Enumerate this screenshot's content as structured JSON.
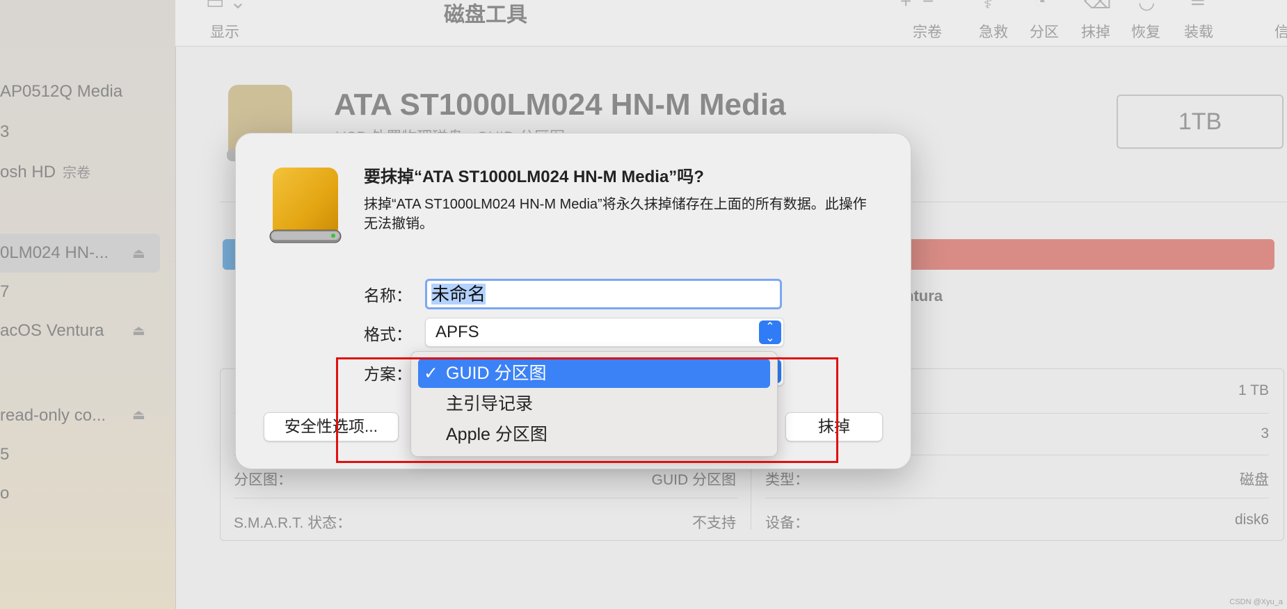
{
  "app": {
    "title": "磁盘工具",
    "view_label": "显示"
  },
  "toolbar": {
    "items": [
      {
        "label": "宗卷",
        "icon": "plus-minus-icon"
      },
      {
        "label": "急救",
        "icon": "stethoscope-icon"
      },
      {
        "label": "分区",
        "icon": "pie-icon"
      },
      {
        "label": "抹掉",
        "icon": "erase-icon"
      },
      {
        "label": "恢复",
        "icon": "restore-icon"
      },
      {
        "label": "装载",
        "icon": "mount-icon"
      },
      {
        "label": "信",
        "icon": "info-icon"
      }
    ]
  },
  "sidebar": {
    "items": [
      {
        "label": "AP0512Q Media",
        "tag": ""
      },
      {
        "label": "3",
        "tag": ""
      },
      {
        "label": "osh HD",
        "tag": "宗卷"
      },
      {
        "label": "0LM024 HN-...",
        "tag": ""
      },
      {
        "label": "7",
        "tag": ""
      },
      {
        "label": "acOS Ventura",
        "tag": ""
      },
      {
        "label": "read-only co...",
        "tag": ""
      },
      {
        "label": "5",
        "tag": ""
      },
      {
        "label": "o",
        "tag": ""
      }
    ]
  },
  "disk": {
    "title": "ATA ST1000LM024 HN-M Media",
    "subtitle": "USB 外置物理磁盘 · GUID 分区图",
    "size": "1TB",
    "usage_legend": "ntura"
  },
  "info": {
    "rows": [
      {
        "left_label": "",
        "left_value": "",
        "right_label": "",
        "right_value": "1 TB"
      },
      {
        "left_label": "",
        "left_value": "",
        "right_label": "",
        "right_value": "3"
      },
      {
        "left_label": "分区图：",
        "left_value": "GUID 分区图",
        "right_label": "类型：",
        "right_value": "磁盘"
      },
      {
        "left_label": "S.M.A.R.T. 状态：",
        "left_value": "不支持",
        "right_label": "设备：",
        "right_value": "disk6"
      }
    ]
  },
  "dialog": {
    "title": "要抹掉“ATA ST1000LM024 HN-M Media”吗?",
    "message": "抹掉“ATA ST1000LM024 HN-M Media”将永久抹掉储存在上面的所有数据。此操作无法撤销。",
    "name_label": "名称：",
    "name_value": "未命名",
    "format_label": "格式：",
    "format_value": "APFS",
    "scheme_label": "方案：",
    "security_button": "安全性选项...",
    "erase_button": "抹掉"
  },
  "scheme_menu": {
    "items": [
      {
        "label": "GUID 分区图",
        "checked": true
      },
      {
        "label": "主引导记录",
        "checked": false
      },
      {
        "label": "Apple 分区图",
        "checked": false
      }
    ],
    "check_glyph": "✓"
  },
  "watermark": "CSDN @Xyu_a",
  "colors": {
    "accent": "#3b82f6",
    "annotation": "#e01010",
    "usage_bar": "#d98c86",
    "disk_gold": "#e3a512"
  }
}
